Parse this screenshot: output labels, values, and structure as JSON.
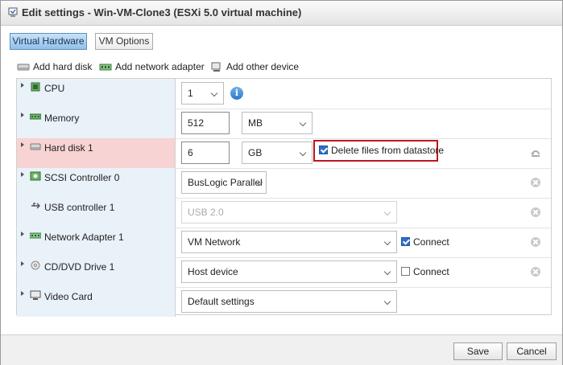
{
  "window": {
    "title": "Edit settings - Win-VM-Clone3 (ESXi 5.0 virtual machine)"
  },
  "tabs": [
    {
      "label": "Virtual Hardware",
      "active": true
    },
    {
      "label": "VM Options",
      "active": false
    }
  ],
  "toolbar": {
    "add_hard_disk": "Add hard disk",
    "add_network_adapter": "Add network adapter",
    "add_other_device": "Add other device"
  },
  "devices": {
    "cpu": {
      "label": "CPU",
      "value": "1"
    },
    "memory": {
      "label": "Memory",
      "value": "512",
      "unit": "MB"
    },
    "hard_disk": {
      "label": "Hard disk 1",
      "value": "6",
      "unit": "GB",
      "delete_files_label": "Delete files from datastore",
      "delete_files_checked": true
    },
    "scsi": {
      "label": "SCSI Controller 0",
      "value": "BusLogic Parallel"
    },
    "usb": {
      "label": "USB controller 1",
      "value": "USB 2.0"
    },
    "network": {
      "label": "Network Adapter 1",
      "value": "VM Network",
      "connect_label": "Connect",
      "connected": true
    },
    "cddvd": {
      "label": "CD/DVD Drive 1",
      "value": "Host device",
      "connect_label": "Connect",
      "connected": false
    },
    "video": {
      "label": "Video Card",
      "value": "Default settings"
    }
  },
  "footer": {
    "save": "Save",
    "cancel": "Cancel"
  },
  "colors": {
    "highlight_row": "#f7d3d3",
    "label_column": "#e9f1f9",
    "annotation_box": "#c0161f",
    "accent": "#2b6fc9"
  },
  "icons": [
    "settings-icon",
    "hard-disk-icon",
    "network-adapter-icon",
    "other-device-icon",
    "cpu-icon",
    "memory-icon",
    "info-icon",
    "scsi-controller-icon",
    "usb-icon",
    "cd-dvd-icon",
    "video-card-icon",
    "remove-icon",
    "undo-icon"
  ]
}
